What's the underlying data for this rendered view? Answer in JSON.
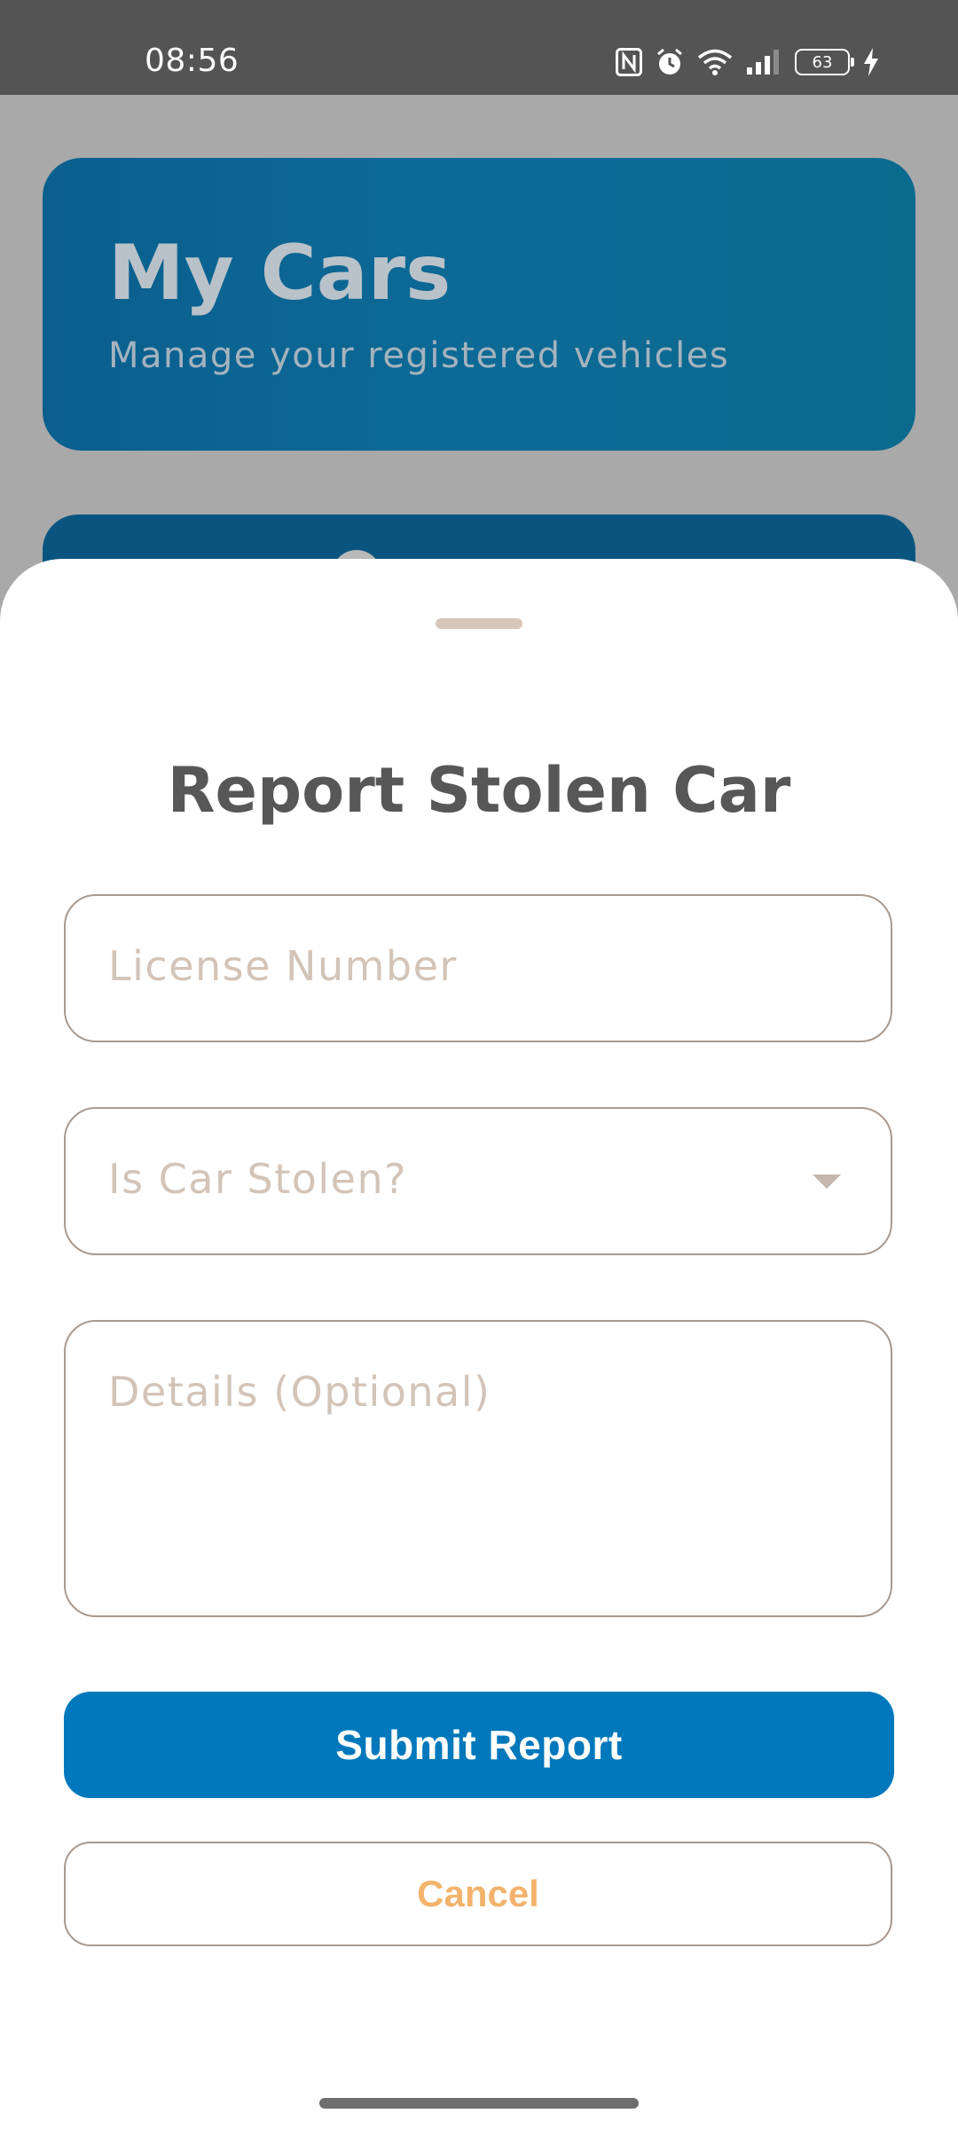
{
  "status_bar": {
    "time": "08:56",
    "battery_level": "63",
    "icons": [
      "nfc-icon",
      "alarm-icon",
      "wifi-icon",
      "signal-icon",
      "battery-icon",
      "charging-icon"
    ]
  },
  "background": {
    "title": "My Cars",
    "subtitle": "Manage your registered vehicles"
  },
  "sheet": {
    "title": "Report Stolen Car",
    "license_placeholder": "License Number",
    "stolen_placeholder": "Is Car Stolen?",
    "details_placeholder": "Details (Optional)",
    "submit_label": "Submit Report",
    "cancel_label": "Cancel"
  },
  "colors": {
    "primary": "#0078bb",
    "cancel_text": "#f3b36c",
    "placeholder": "#d3c4b8",
    "border": "#a79a91"
  }
}
